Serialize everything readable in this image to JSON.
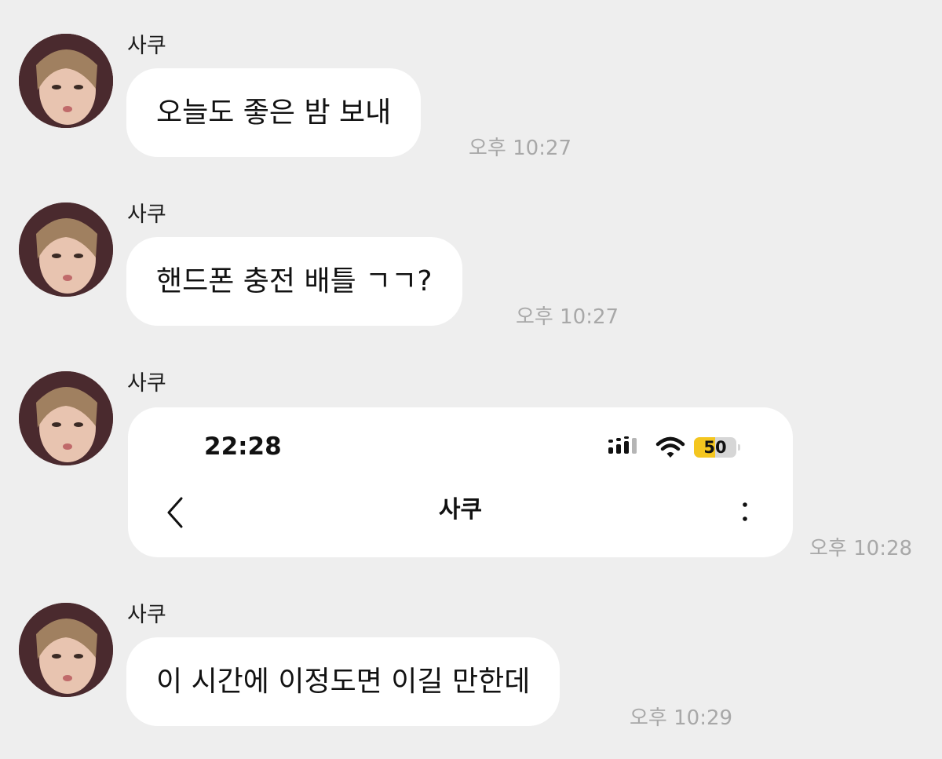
{
  "messages": [
    {
      "type": "text",
      "sender": "사쿠",
      "text": "오늘도 좋은 밤 보내",
      "time": "오후 10:27"
    },
    {
      "type": "text",
      "sender": "사쿠",
      "text": "핸드폰 충전 배틀 ㄱㄱ?",
      "time": "오후 10:27"
    },
    {
      "type": "screenshot",
      "sender": "사쿠",
      "time": "오후 10:28",
      "screenshot": {
        "clock": "22:28",
        "battery_level": 50,
        "battery_label": "50",
        "battery_color": "#f4c61f",
        "title": "사쿠",
        "icons": [
          "signal-icon",
          "wifi-icon",
          "battery-icon",
          "back-chevron-icon",
          "more-vertical-icon"
        ]
      }
    },
    {
      "type": "text",
      "sender": "사쿠",
      "text": "이 시간에 이정도면 이길 만한데",
      "time": "오후 10:29"
    }
  ],
  "colors": {
    "background": "#eeeeee",
    "bubble": "#ffffff",
    "timestamp": "#a8a8a8"
  }
}
